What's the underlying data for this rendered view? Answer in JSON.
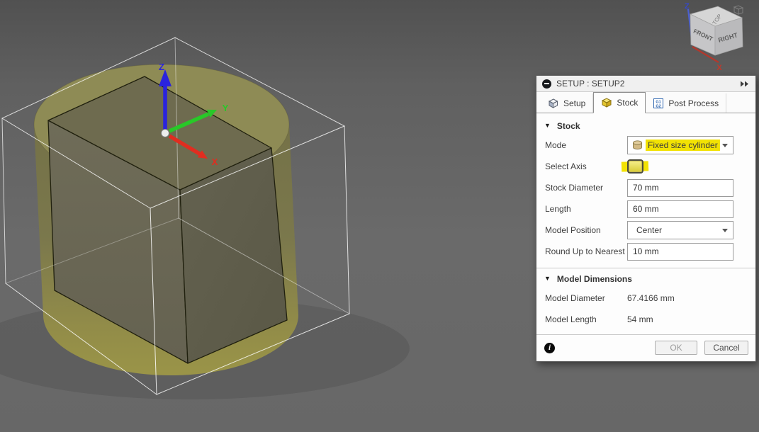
{
  "viewport": {
    "origin_axes": {
      "x_label": "X",
      "y_label": "Y",
      "z_label": "Z",
      "x_color": "#e02d20",
      "y_color": "#28c828",
      "z_color": "#2a23dd"
    },
    "view_cube": {
      "top_label": "TOP",
      "front_label": "FRONT",
      "right_label": "RIGHT",
      "z_axis_label": "Z",
      "x_axis_label": "X"
    },
    "stock_color": "#8e8b55",
    "model_color": "#6b6855"
  },
  "dialog": {
    "title": "SETUP : SETUP2",
    "tabs": [
      {
        "label": "Setup",
        "active": false
      },
      {
        "label": "Stock",
        "active": true
      },
      {
        "label": "Post Process",
        "active": false,
        "icon_text_top": "G1",
        "icon_text_bottom": "G2"
      }
    ],
    "stock_section": {
      "title": "Stock",
      "mode": {
        "label": "Mode",
        "value": "Fixed size cylinder",
        "highlighted": true
      },
      "select_axis": {
        "label": "Select Axis",
        "highlighted": true
      },
      "stock_diameter": {
        "label": "Stock Diameter",
        "value": "70 mm"
      },
      "length": {
        "label": "Length",
        "value": "60 mm"
      },
      "model_position": {
        "label": "Model Position",
        "value": "Center"
      },
      "round_up": {
        "label": "Round Up to Nearest",
        "value": "10 mm"
      }
    },
    "model_dimensions_section": {
      "title": "Model Dimensions",
      "model_diameter": {
        "label": "Model Diameter",
        "value": "67.4166 mm"
      },
      "model_length": {
        "label": "Model Length",
        "value": "54 mm"
      }
    },
    "footer": {
      "ok_label": "OK",
      "cancel_label": "Cancel"
    },
    "highlight_color": "#f2e203"
  }
}
